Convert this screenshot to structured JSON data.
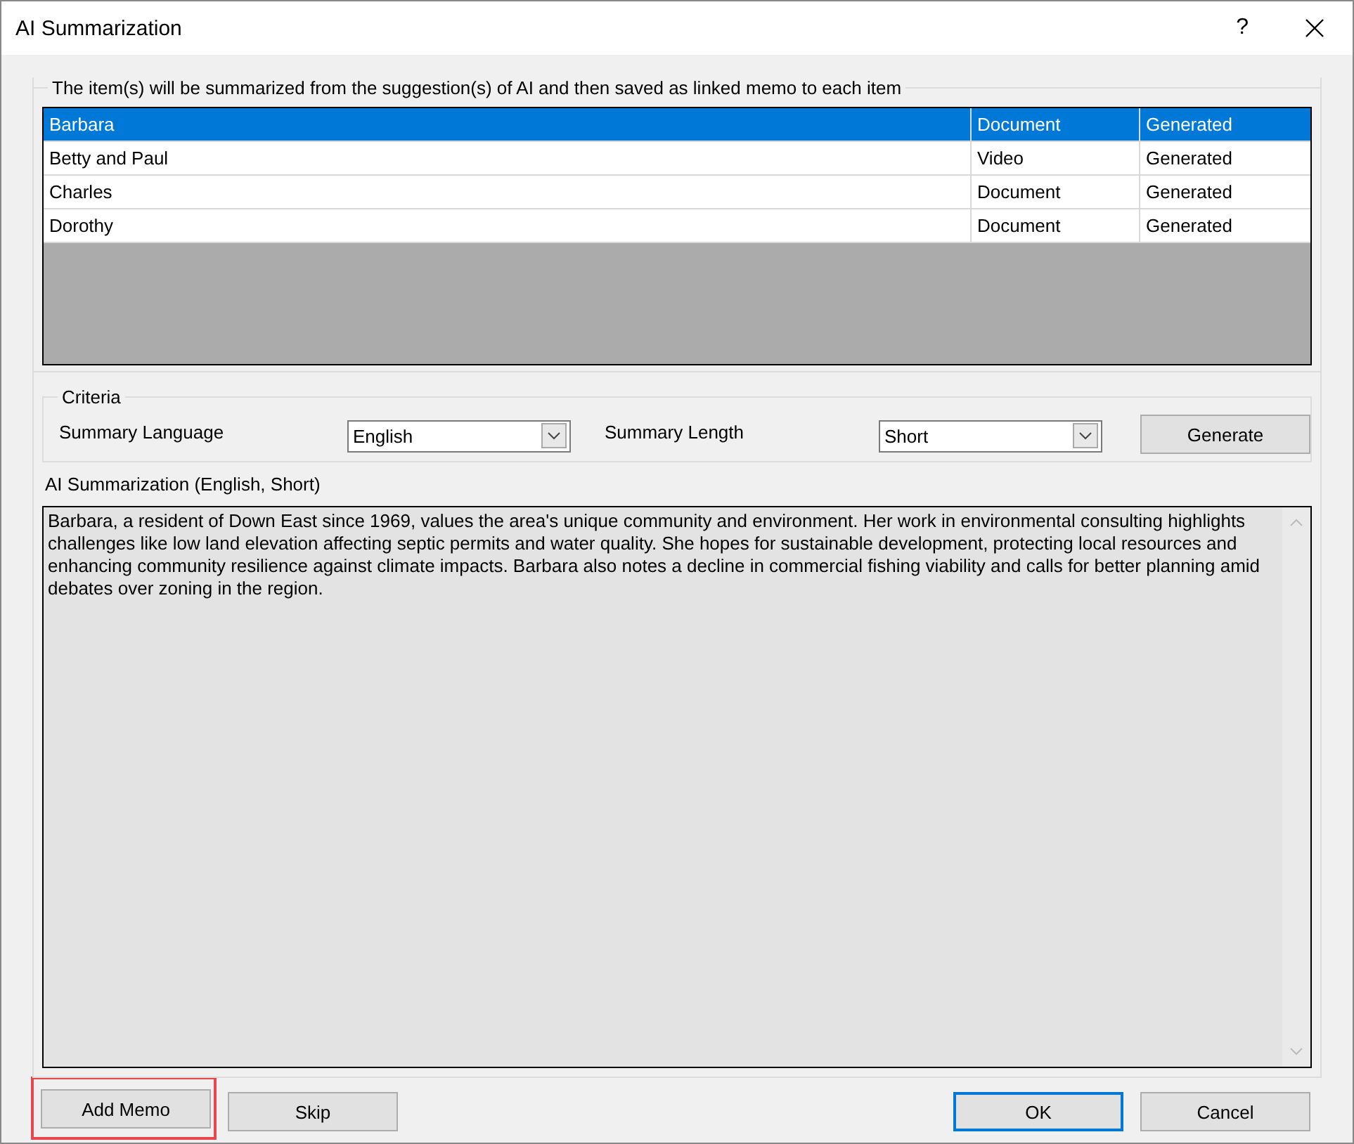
{
  "window": {
    "title": "AI Summarization",
    "help": "?"
  },
  "items": {
    "caption": "The item(s) will be summarized from the suggestion(s) of AI and then saved as linked memo to each item",
    "rows": [
      {
        "name": "Barbara",
        "type": "Document",
        "status": "Generated",
        "selected": true
      },
      {
        "name": "Betty and Paul",
        "type": "Video",
        "status": "Generated",
        "selected": false
      },
      {
        "name": "Charles",
        "type": "Document",
        "status": "Generated",
        "selected": false
      },
      {
        "name": "Dorothy",
        "type": "Document",
        "status": "Generated",
        "selected": false
      }
    ]
  },
  "criteria": {
    "caption": "Criteria",
    "language": {
      "label": "Summary Language",
      "value": "English"
    },
    "length": {
      "label": "Summary Length",
      "value": "Short"
    },
    "generate": "Generate"
  },
  "summary": {
    "label": "AI Summarization (English, Short)",
    "text": "Barbara, a resident of Down East since 1969, values the area's unique community and environment. Her work in environmental consulting highlights challenges like low land elevation affecting septic permits and water quality. She hopes for sustainable development, protecting local resources and enhancing community resilience against climate impacts. Barbara also notes a decline in commercial fishing viability and calls for better planning amid debates over zoning in the region."
  },
  "buttons": [
    {
      "label": "Add Memo",
      "highlighted": true,
      "default": false
    },
    {
      "label": "Skip",
      "highlighted": false,
      "default": false
    },
    {
      "label": "OK",
      "highlighted": false,
      "default": true
    },
    {
      "label": "Cancel",
      "highlighted": false,
      "default": false
    }
  ]
}
